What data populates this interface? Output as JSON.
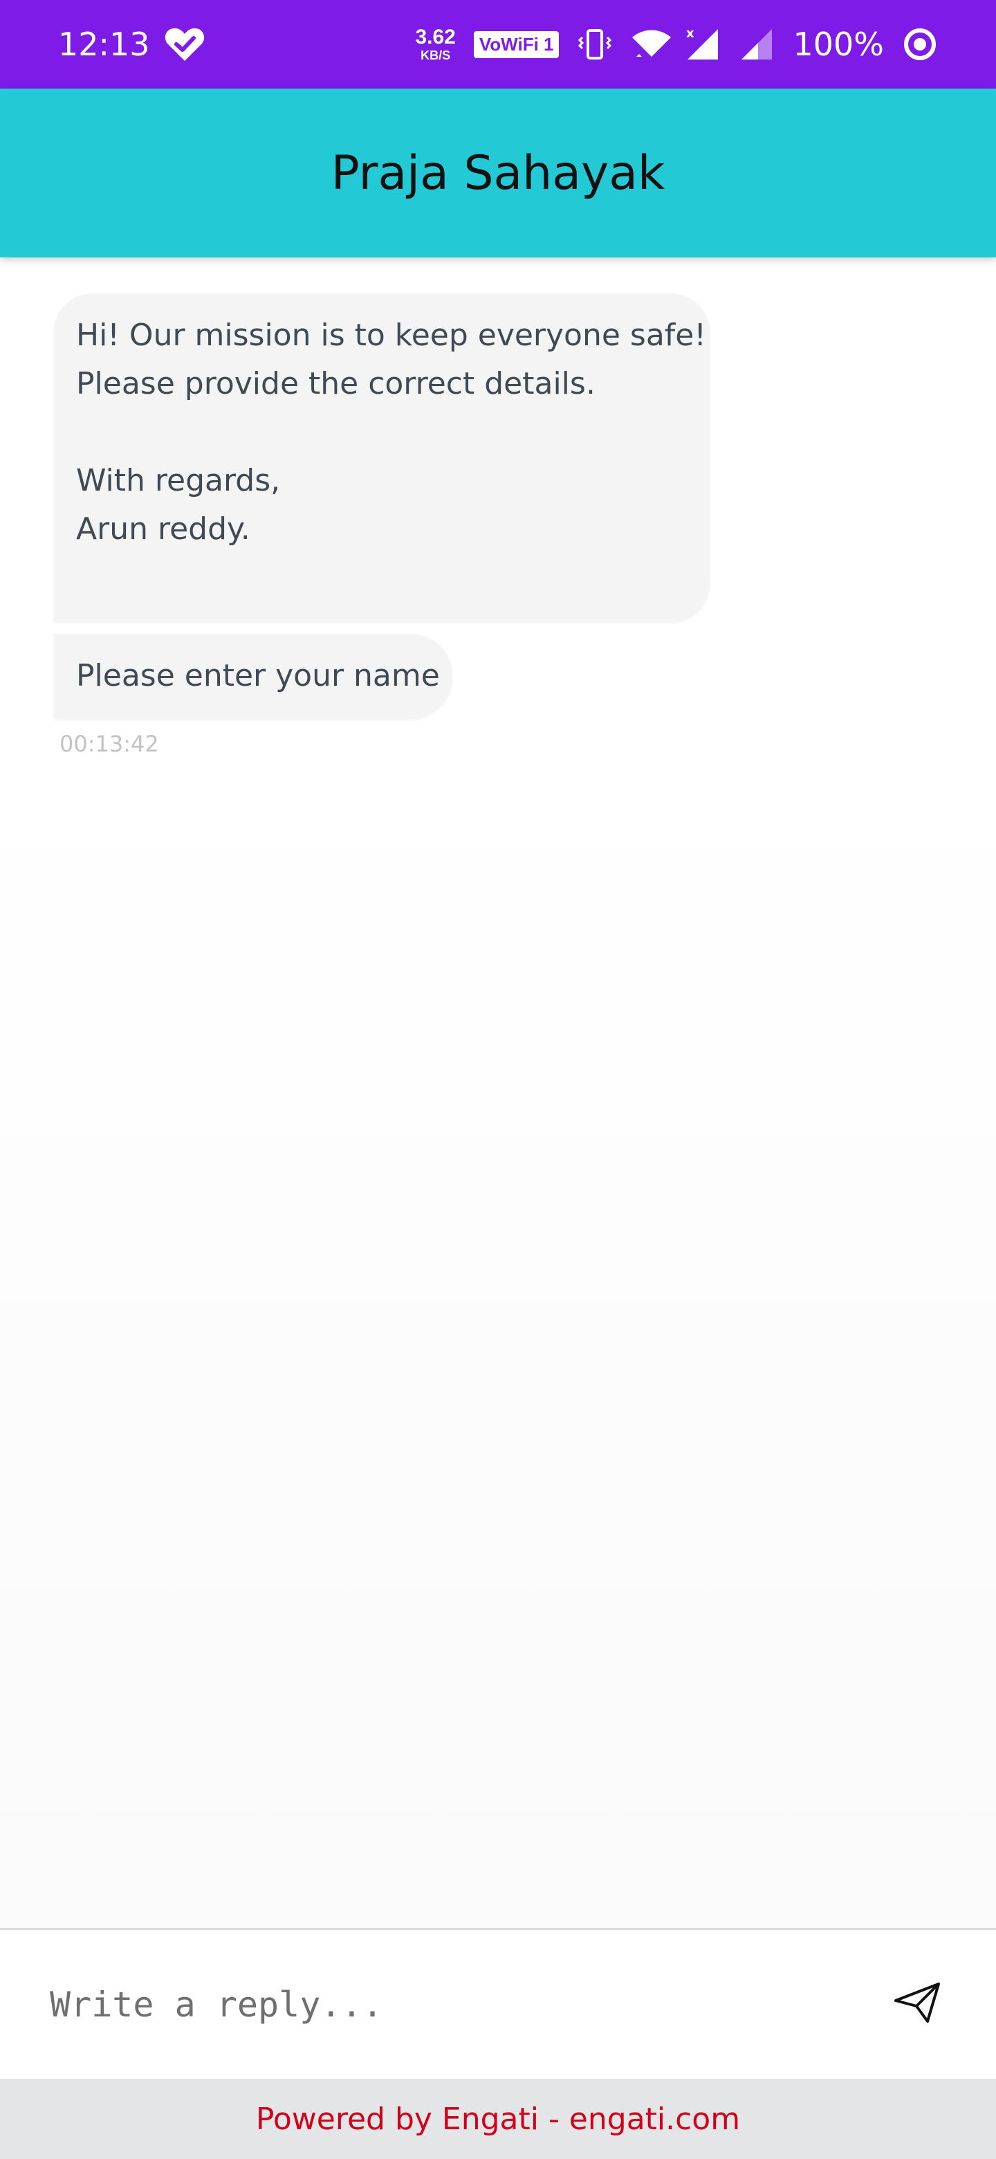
{
  "status_bar": {
    "time": "12:13",
    "net_speed_value": "3.62",
    "net_speed_unit": "KB/S",
    "vowifi_label": "VoWiFi 1",
    "battery": "100%",
    "icons": [
      "heart-check-icon",
      "vibrate-icon",
      "wifi-icon",
      "signal-x-icon",
      "signal-icon",
      "battery-saver-icon"
    ],
    "color": "#7e1be6"
  },
  "header": {
    "title": "Praja Sahayak",
    "color": "#24c9d6"
  },
  "chat": {
    "messages": [
      {
        "lines": [
          "Hi! Our mission is to keep everyone safe!",
          "Please provide the correct details.",
          "",
          "With regards,",
          "Arun reddy."
        ]
      },
      {
        "text": "Please enter your name",
        "timestamp": "00:13:42"
      }
    ]
  },
  "reply": {
    "placeholder": "Write a reply...",
    "send_icon": "send-icon"
  },
  "footer": {
    "text": "Powered by Engati - engati.com",
    "color": "#d0021b"
  }
}
